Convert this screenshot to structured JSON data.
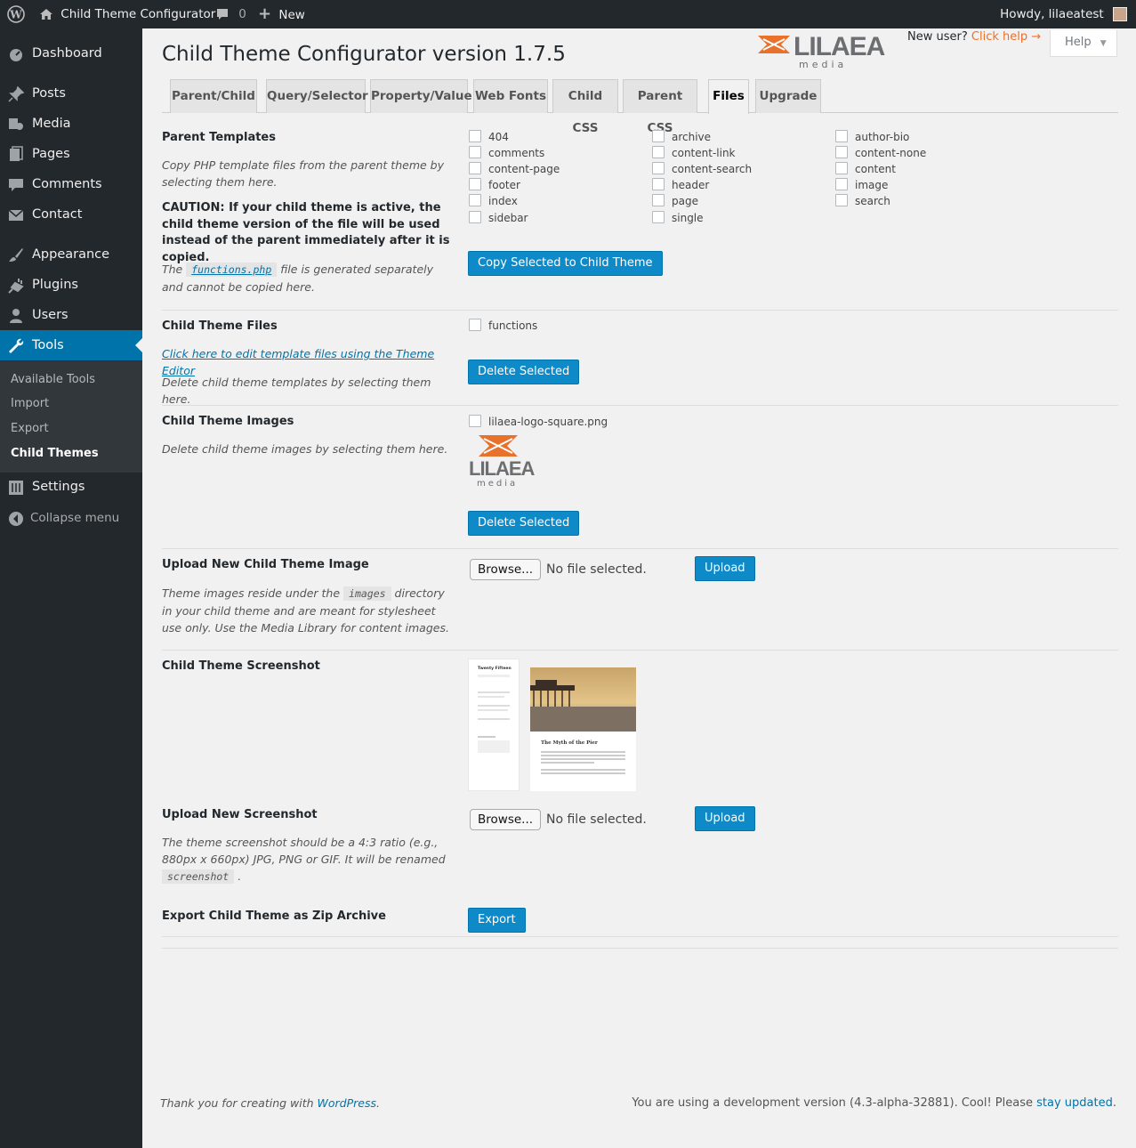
{
  "adminbar": {
    "site_name": "Child Theme Configurator",
    "comments_count": "0",
    "new_label": "New",
    "howdy": "Howdy, lilaeatest"
  },
  "sidebar": {
    "items": [
      {
        "label": "Dashboard",
        "icon": "dashboard-icon"
      },
      {
        "label": "Posts",
        "icon": "pin-icon"
      },
      {
        "label": "Media",
        "icon": "media-icon"
      },
      {
        "label": "Pages",
        "icon": "pages-icon"
      },
      {
        "label": "Comments",
        "icon": "comments-icon"
      },
      {
        "label": "Contact",
        "icon": "mail-icon"
      },
      {
        "label": "Appearance",
        "icon": "brush-icon"
      },
      {
        "label": "Plugins",
        "icon": "plugin-icon"
      },
      {
        "label": "Users",
        "icon": "users-icon"
      },
      {
        "label": "Tools",
        "icon": "wrench-icon"
      },
      {
        "label": "Settings",
        "icon": "settings-icon"
      }
    ],
    "submenu": [
      "Available Tools",
      "Import",
      "Export",
      "Child Themes"
    ],
    "collapse": "Collapse menu"
  },
  "header": {
    "title": "Child Theme Configurator version 1.7.5",
    "new_user": "New user?",
    "click_help": "Click help",
    "help_button": "Help",
    "logo_text": "LILAEA",
    "logo_sub": "media"
  },
  "tabs": [
    "Parent/Child",
    "Query/Selector",
    "Property/Value",
    "Web Fonts",
    "Child CSS",
    "Parent CSS",
    "Files",
    "Upgrade"
  ],
  "parent_templates": {
    "title": "Parent Templates",
    "desc": "Copy PHP template files from the parent theme by selecting them here.",
    "caution": "CAUTION: If your child theme is active, the child theme version of the file will be used instead of the parent immediately after it is copied.",
    "note_before": "The",
    "note_code": "functions.php",
    "note_after": "file is generated separately and cannot be copied here.",
    "col1": [
      "404",
      "comments",
      "content-page",
      "footer",
      "index",
      "sidebar"
    ],
    "col2": [
      "archive",
      "content-link",
      "content-search",
      "header",
      "page",
      "single"
    ],
    "col3": [
      "author-bio",
      "content-none",
      "content",
      "image",
      "search"
    ],
    "button": "Copy Selected to Child Theme"
  },
  "child_files": {
    "title": "Child Theme Files",
    "link": "Click here to edit template files using the Theme Editor",
    "desc": "Delete child theme templates by selecting them here.",
    "files": [
      "functions"
    ],
    "button": "Delete Selected"
  },
  "child_images": {
    "title": "Child Theme Images",
    "desc": "Delete child theme images by selecting them here.",
    "files": [
      "lilaea-logo-square.png"
    ],
    "button": "Delete Selected"
  },
  "upload_image": {
    "title": "Upload New Child Theme Image",
    "desc_before": "Theme images reside under the",
    "desc_code": "images",
    "desc_after": "directory in your child theme and are meant for stylesheet use only. Use the Media Library for content images.",
    "browse": "Browse...",
    "no_file": "No file selected.",
    "upload": "Upload"
  },
  "screenshot": {
    "title": "Child Theme Screenshot",
    "thumb_site": "Twenty Fifteen",
    "thumb_post": "The Myth of the Pier"
  },
  "upload_screenshot": {
    "title": "Upload New Screenshot",
    "desc_before": "The theme screenshot should be a 4:3 ratio (e.g., 880px x 660px) JPG, PNG or GIF. It will be renamed",
    "desc_code": "screenshot",
    "desc_after": ".",
    "browse": "Browse...",
    "no_file": "No file selected.",
    "upload": "Upload"
  },
  "export": {
    "title": "Export Child Theme as Zip Archive",
    "button": "Export"
  },
  "footer": {
    "thanks_before": "Thank you for creating with",
    "wordpress": "WordPress",
    "thanks_after": ".",
    "version_text": "You are using a development version (4.3-alpha-32881). Cool! Please",
    "stay_updated": "stay updated",
    "version_after": "."
  },
  "colors": {
    "accent": "#0073aa",
    "button": "#0e8ac8",
    "sidebar": "#23282d",
    "brand_orange": "#e8722c"
  }
}
